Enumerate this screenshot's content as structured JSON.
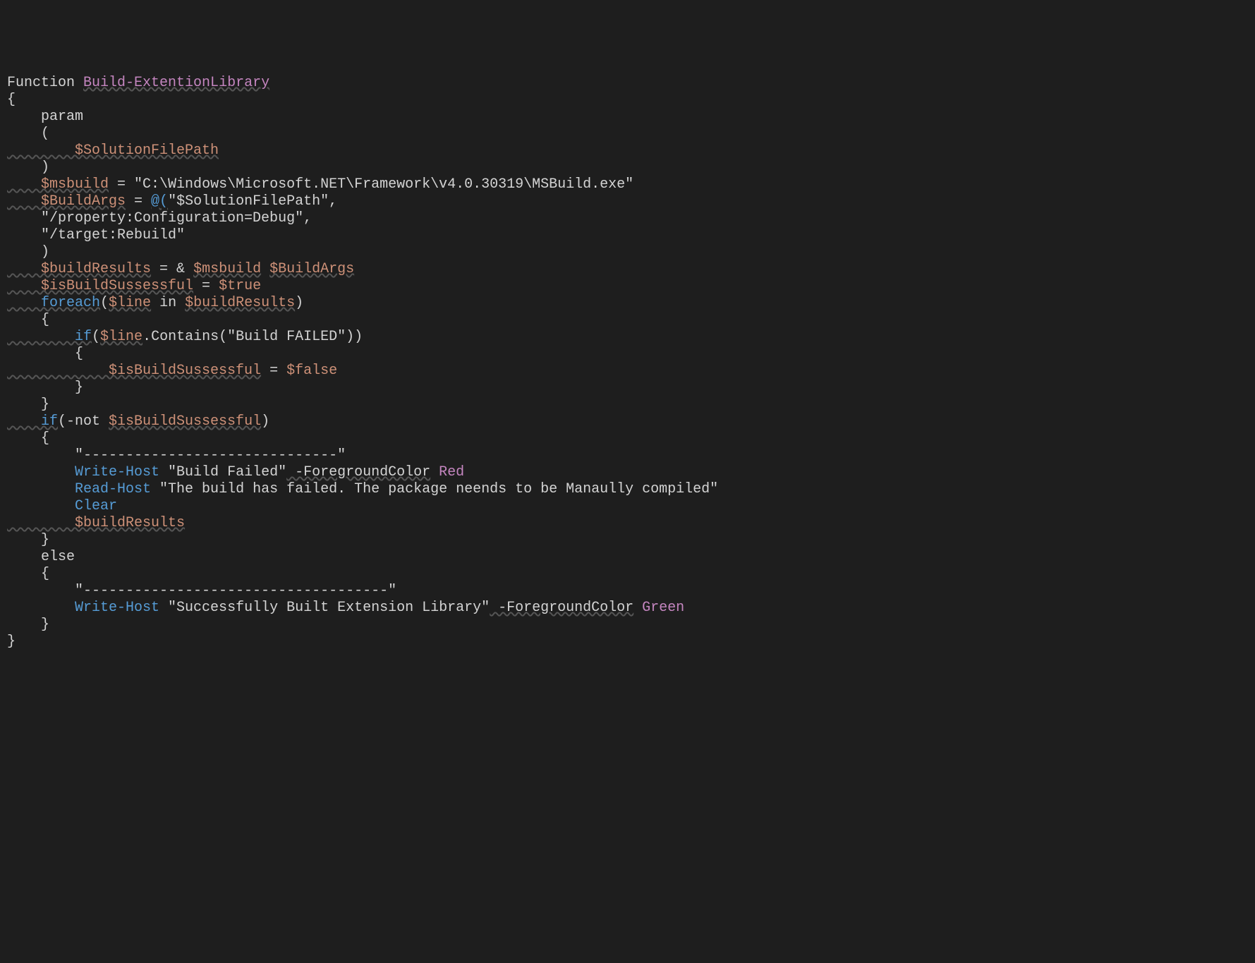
{
  "lines": {
    "l1_function": "Function",
    "l1_name": "Build-ExtentionLibrary",
    "l2": "{",
    "l3_param": "    param",
    "l4": "    (",
    "l5_var": "        $SolutionFilePath",
    "l6": "    )",
    "l7": "",
    "l8_var": "    $msbuild",
    "l8_eq": " = ",
    "l8_str": "\"C:\\Windows\\Microsoft.NET\\Framework\\v4.0.30319\\MSBuild.exe\"",
    "l9": "",
    "l10_var": "    $BuildArgs",
    "l10_eq": " = ",
    "l10_at": "@(",
    "l10_str": "\"$SolutionFilePath\"",
    "l10_comma": ",",
    "l11_str": "    \"/property:Configuration=Debug\"",
    "l11_comma": ",",
    "l12_str": "    \"/target:Rebuild\"",
    "l13": "    )",
    "l14": "",
    "l15_var1": "    $buildResults",
    "l15_eq": " = & ",
    "l15_var2": "$msbuild",
    "l15_sp": " ",
    "l15_var3": "$BuildArgs",
    "l16": "",
    "l17_var": "    $isBuildSussessful",
    "l17_eq": " = ",
    "l17_bool": "$true",
    "l18_foreach": "    foreach",
    "l18_p1": "(",
    "l18_var1": "$line",
    "l18_in": " in ",
    "l18_var2": "$buildResults",
    "l18_p2": ")",
    "l19": "    {",
    "l20_if": "        if",
    "l20_p1": "(",
    "l20_var": "$line",
    "l20_contains": ".Contains(",
    "l20_str": "\"Build FAILED\"",
    "l20_p2": "))",
    "l21": "        {",
    "l22_var": "            $isBuildSussessful",
    "l22_eq": " = ",
    "l22_bool": "$false",
    "l23": "        }",
    "l24": "    }",
    "l25": "",
    "l26_if": "    if",
    "l26_p1": "(-not ",
    "l26_var": "$isBuildSussessful",
    "l26_p2": ")",
    "l27": "    {",
    "l28_str": "        \"------------------------------\"",
    "l29_cmd": "        Write-Host",
    "l29_str": " \"Build Failed\"",
    "l29_flag": " -ForegroundColor",
    "l29_color": " Red",
    "l30_cmd": "        Read-Host",
    "l30_str": " \"The build has failed. The package neends to be Manaully compiled\"",
    "l31_cmd": "        Clear",
    "l32_var": "        $buildResults",
    "l33": "    }",
    "l34": "    else",
    "l35": "    {",
    "l36_str": "        \"------------------------------------\"",
    "l37_cmd": "        Write-Host",
    "l37_str": " \"Successfully Built Extension Library\"",
    "l37_flag": " -ForegroundColor",
    "l37_color": " Green",
    "l38": "    }",
    "l39": "}"
  }
}
